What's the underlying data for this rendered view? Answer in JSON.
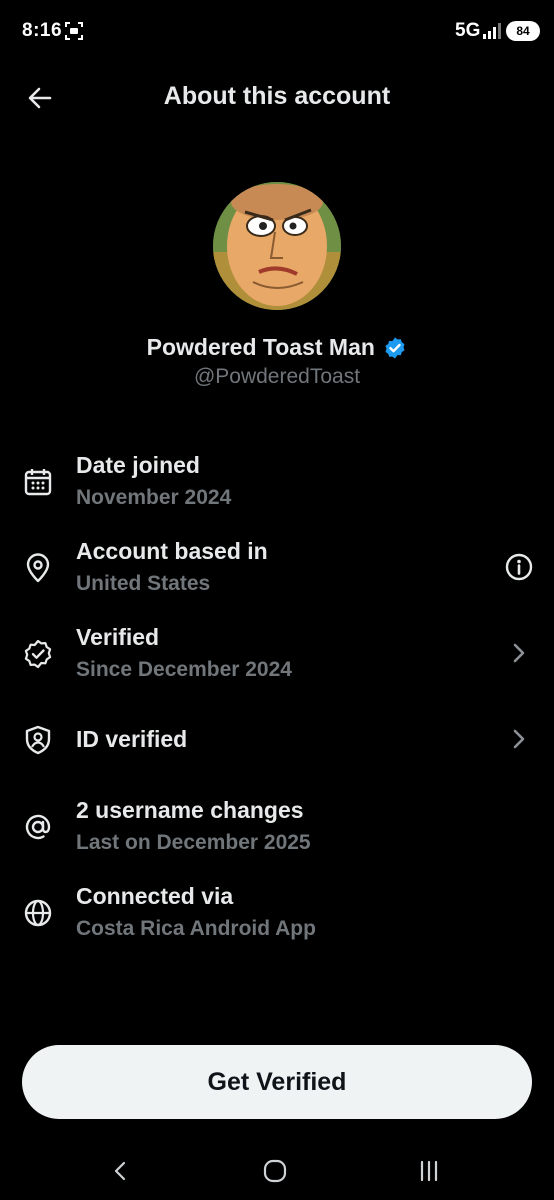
{
  "status_bar": {
    "time": "8:16",
    "network": "5G",
    "battery": "84"
  },
  "header": {
    "title": "About this account"
  },
  "profile": {
    "name": "Powdered Toast Man",
    "handle": "@PowderedToast",
    "verified_color": "#1d9bf0"
  },
  "items": [
    {
      "icon": "calendar-icon",
      "title": "Date joined",
      "subtitle": "November 2024"
    },
    {
      "icon": "location-pin-icon",
      "title": "Account based in",
      "subtitle": "United States",
      "trailing": "info-icon"
    },
    {
      "icon": "verified-badge-icon",
      "title": "Verified",
      "subtitle": "Since December 2024",
      "trailing": "chevron-right-icon"
    },
    {
      "icon": "id-shield-icon",
      "title": "ID verified",
      "trailing": "chevron-right-icon"
    },
    {
      "icon": "at-sign-icon",
      "title": "2 username changes",
      "subtitle": "Last on December 2025"
    },
    {
      "icon": "globe-icon",
      "title": "Connected via",
      "subtitle": "Costa Rica Android App"
    }
  ],
  "cta": {
    "label": "Get Verified"
  },
  "nav": {
    "back": "nav-back-icon",
    "home": "nav-home-icon",
    "recents": "nav-recents-icon"
  }
}
